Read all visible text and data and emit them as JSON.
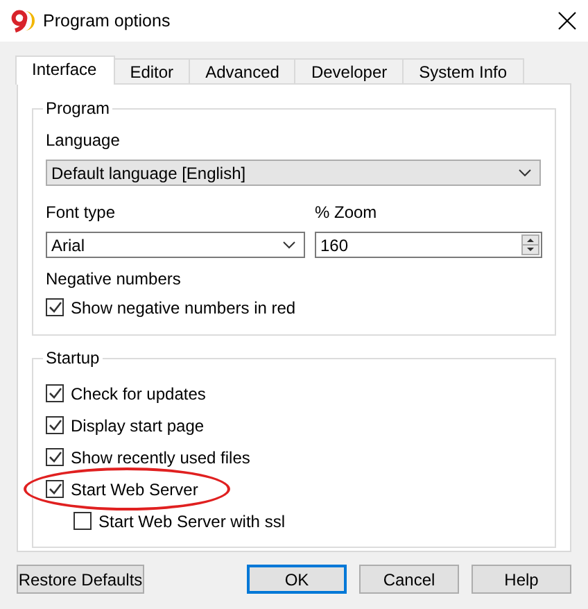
{
  "window": {
    "title": "Program options"
  },
  "tabs": [
    {
      "label": "Interface",
      "selected": true
    },
    {
      "label": "Editor",
      "selected": false
    },
    {
      "label": "Advanced",
      "selected": false
    },
    {
      "label": "Developer",
      "selected": false
    },
    {
      "label": "System Info",
      "selected": false
    }
  ],
  "program_group": {
    "title": "Program",
    "language_label": "Language",
    "language": {
      "value": "Default language [English]",
      "disabled": true
    },
    "font_label": "Font type",
    "font": {
      "value": "Arial",
      "disabled": false
    },
    "zoom_label": "% Zoom",
    "zoom": {
      "value": "160"
    },
    "negative_label": "Negative numbers",
    "negative_options": [
      {
        "label": "Show negative numbers in red",
        "checked": true,
        "highlighted": false
      }
    ]
  },
  "startup_group": {
    "title": "Startup",
    "options": [
      {
        "label": "Check for updates",
        "checked": true,
        "highlighted": false
      },
      {
        "label": "Display start page",
        "checked": true,
        "highlighted": false
      },
      {
        "label": "Show recently used files",
        "checked": true,
        "highlighted": false
      },
      {
        "label": "Start Web Server",
        "checked": true,
        "highlighted": true,
        "children": [
          {
            "label": "Start Web Server with ssl",
            "checked": false,
            "highlighted": false
          }
        ]
      }
    ]
  },
  "buttons": [
    {
      "label": "Restore Defaults",
      "default": false
    },
    {
      "label": "OK",
      "default": true
    },
    {
      "label": "Cancel",
      "default": false
    },
    {
      "label": "Help",
      "default": false
    }
  ]
}
